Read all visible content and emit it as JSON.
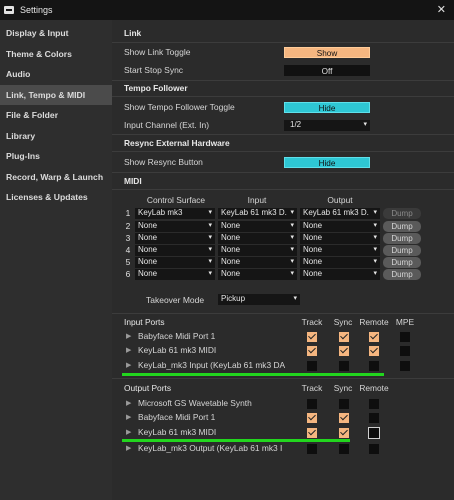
{
  "window": {
    "title": "Settings",
    "close": "✕"
  },
  "sidebar": {
    "items": [
      {
        "label": "Display & Input"
      },
      {
        "label": "Theme & Colors"
      },
      {
        "label": "Audio"
      },
      {
        "label": "Link, Tempo & MIDI"
      },
      {
        "label": "File & Folder"
      },
      {
        "label": "Library"
      },
      {
        "label": "Plug-Ins"
      },
      {
        "label": "Record, Warp & Launch"
      },
      {
        "label": "Licenses & Updates"
      }
    ],
    "active_index": 3
  },
  "link": {
    "heading": "Link",
    "show_link_toggle_label": "Show Link Toggle",
    "show_link_toggle_value": "Show",
    "start_stop_sync_label": "Start Stop Sync",
    "start_stop_sync_value": "Off"
  },
  "tempo_follower": {
    "heading": "Tempo Follower",
    "show_toggle_label": "Show Tempo Follower Toggle",
    "show_toggle_value": "Hide",
    "input_channel_label": "Input Channel (Ext. In)",
    "input_channel_value": "1/2"
  },
  "resync": {
    "heading": "Resync External Hardware",
    "show_button_label": "Show Resync Button",
    "show_button_value": "Hide"
  },
  "midi": {
    "heading": "MIDI",
    "col_control_surface": "Control Surface",
    "col_input": "Input",
    "col_output": "Output",
    "rows": [
      {
        "num": "1",
        "surface": "KeyLab mk3",
        "input": "KeyLab 61 mk3 D.",
        "output": "KeyLab 61 mk3 D.",
        "dump": "Dump"
      },
      {
        "num": "2",
        "surface": "None",
        "input": "None",
        "output": "None",
        "dump": "Dump"
      },
      {
        "num": "3",
        "surface": "None",
        "input": "None",
        "output": "None",
        "dump": "Dump"
      },
      {
        "num": "4",
        "surface": "None",
        "input": "None",
        "output": "None",
        "dump": "Dump"
      },
      {
        "num": "5",
        "surface": "None",
        "input": "None",
        "output": "None",
        "dump": "Dump"
      },
      {
        "num": "6",
        "surface": "None",
        "input": "None",
        "output": "None",
        "dump": "Dump"
      }
    ],
    "takeover_label": "Takeover Mode",
    "takeover_value": "Pickup"
  },
  "input_ports": {
    "heading": "Input Ports",
    "col_track": "Track",
    "col_sync": "Sync",
    "col_remote": "Remote",
    "col_mpe": "MPE",
    "rows": [
      {
        "name": "Babyface Midi Port 1",
        "track": true,
        "sync": true,
        "remote": true,
        "mpe": false
      },
      {
        "name": "KeyLab 61 mk3 MIDI",
        "track": true,
        "sync": true,
        "remote": true,
        "mpe": false
      },
      {
        "name": "KeyLab_mk3 Input (KeyLab 61 mk3 DA",
        "track": false,
        "sync": false,
        "remote": false,
        "mpe": false
      }
    ]
  },
  "output_ports": {
    "heading": "Output Ports",
    "col_track": "Track",
    "col_sync": "Sync",
    "col_remote": "Remote",
    "rows": [
      {
        "name": "Microsoft GS Wavetable Synth",
        "track": false,
        "sync": false,
        "remote": false
      },
      {
        "name": "Babyface Midi Port 1",
        "track": true,
        "sync": true,
        "remote": false
      },
      {
        "name": "KeyLab 61 mk3 MIDI",
        "track": true,
        "sync": true,
        "remote": false
      },
      {
        "name": "KeyLab_mk3 Output (KeyLab 61 mk3 I",
        "track": false,
        "sync": false,
        "remote": false
      }
    ]
  },
  "colors": {
    "accent_orange": "#f5b680",
    "accent_teal": "#2ec7d4",
    "highlight_green": "#22d61e"
  }
}
